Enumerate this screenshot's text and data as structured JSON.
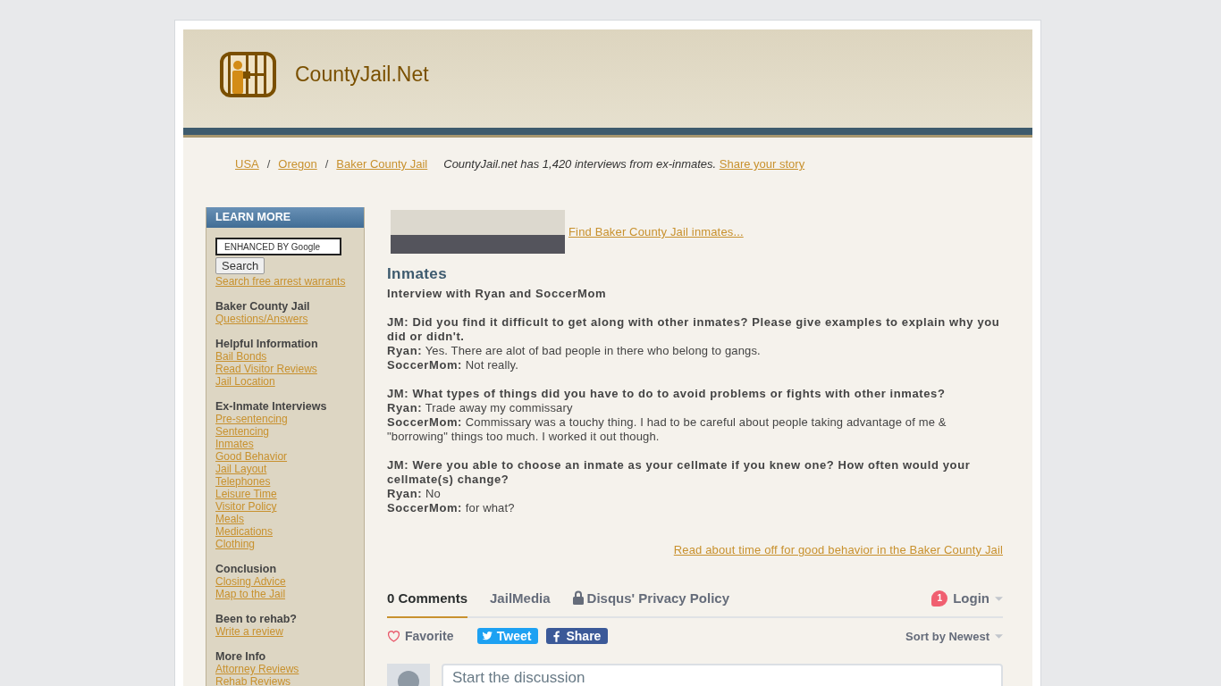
{
  "site": {
    "title": "CountyJail.Net"
  },
  "breadcrumb": {
    "separator": "/",
    "items": [
      {
        "label": "USA"
      },
      {
        "label": "Oregon"
      },
      {
        "label": "Baker County Jail"
      }
    ]
  },
  "tagline": {
    "text": "CountyJail.net has 1,420 interviews from ex-inmates.",
    "link": "Share your story"
  },
  "sidebar": {
    "title": "LEARN MORE",
    "search": {
      "placeholder": "ENHANCED BY Google",
      "button": "Search",
      "link": "Search free arrest warrants"
    },
    "sections": [
      {
        "heading": "Baker County Jail",
        "links": [
          "Questions/Answers"
        ]
      },
      {
        "heading": "Helpful Information",
        "links": [
          "Bail Bonds",
          "Read Visitor Reviews",
          "Jail Location"
        ]
      },
      {
        "heading": "Ex-Inmate Interviews",
        "links": [
          "Pre-sentencing",
          "Sentencing",
          "Inmates",
          "Good Behavior",
          "Jail Layout",
          "Telephones",
          "Leisure Time",
          "Visitor Policy",
          "Meals",
          "Medications",
          "Clothing"
        ]
      },
      {
        "heading": "Conclusion",
        "links": [
          "Closing Advice",
          "Map to the Jail"
        ]
      },
      {
        "heading": "Been to rehab?",
        "links": [
          "Write a review"
        ]
      },
      {
        "heading": "More Info",
        "links": [
          "Attorney Reviews",
          "Rehab Reviews"
        ]
      }
    ]
  },
  "main": {
    "photo_link": "Find Baker County Jail inmates...",
    "heading": "Inmates",
    "subtitle": "Interview with Ryan and SoccerMom",
    "interview": [
      {
        "question": "JM: Did you find it difficult to get along with other inmates? Please give examples to explain why you did or didn't.",
        "answers": [
          {
            "speaker": "Ryan:",
            "text": "Yes. There are alot of bad people in there who belong to gangs."
          },
          {
            "speaker": "SoccerMom:",
            "text": "Not really."
          }
        ]
      },
      {
        "question": "JM: What types of things did you have to do to avoid problems or fights with other inmates?",
        "answers": [
          {
            "speaker": "Ryan:",
            "text": "Trade away my commissary"
          },
          {
            "speaker": "SoccerMom:",
            "text": "Commissary was a touchy thing. I had to be careful about people taking advantage of me & \"borrowing\" things too much. I worked it out though."
          }
        ]
      },
      {
        "question": "JM: Were you able to choose an inmate as your cellmate if you knew one? How often would your cellmate(s) change?",
        "answers": [
          {
            "speaker": "Ryan:",
            "text": "No"
          },
          {
            "speaker": "SoccerMom:",
            "text": "for what?"
          }
        ]
      }
    ],
    "footer_link": "Read about time off for good behavior in the Baker County Jail"
  },
  "comments": {
    "tabs": [
      {
        "label": "0 Comments",
        "selected": true
      },
      {
        "label": "JailMedia",
        "selected": false
      }
    ],
    "privacy_link": "Disqus' Privacy Policy",
    "login": {
      "label": "Login",
      "badge": "1"
    },
    "favorite": "Favorite",
    "share_buttons": [
      {
        "kind": "twitter",
        "label": "Tweet"
      },
      {
        "kind": "facebook",
        "label": "Share"
      }
    ],
    "sort": "Sort by Newest",
    "composer": {
      "placeholder": "Start the discussion"
    }
  }
}
